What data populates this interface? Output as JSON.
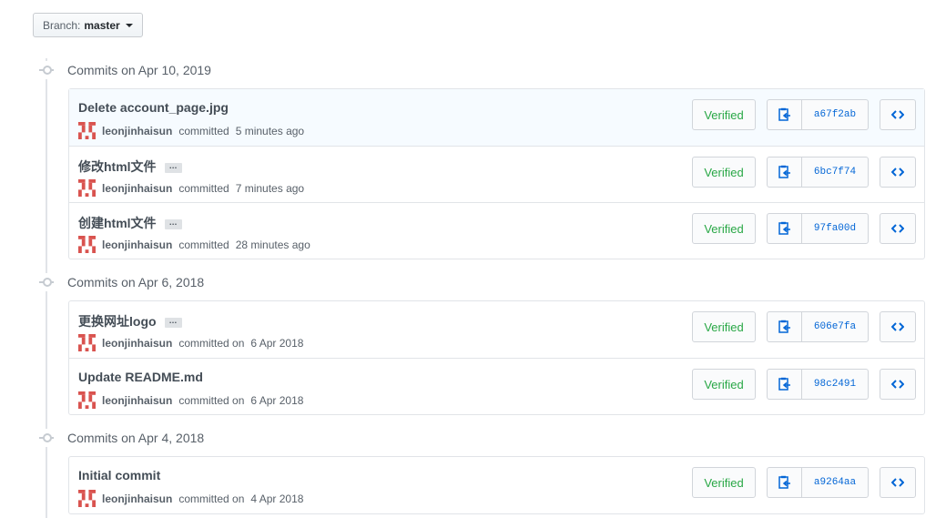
{
  "branch": {
    "label": "Branch:",
    "name": "master"
  },
  "groups": [
    {
      "title": "Commits on Apr 10, 2019",
      "commits": [
        {
          "message": "Delete account_page.jpg",
          "has_ellipsis": false,
          "author": "leonjinhaisun",
          "action": "committed",
          "time": "5 minutes ago",
          "verified": "Verified",
          "sha": "a67f2ab",
          "highlight": true
        },
        {
          "message": "修改html文件",
          "has_ellipsis": true,
          "author": "leonjinhaisun",
          "action": "committed",
          "time": "7 minutes ago",
          "verified": "Verified",
          "sha": "6bc7f74"
        },
        {
          "message": "创建html文件",
          "has_ellipsis": true,
          "author": "leonjinhaisun",
          "action": "committed",
          "time": "28 minutes ago",
          "verified": "Verified",
          "sha": "97fa00d"
        }
      ]
    },
    {
      "title": "Commits on Apr 6, 2018",
      "commits": [
        {
          "message": "更换网址logo",
          "has_ellipsis": true,
          "author": "leonjinhaisun",
          "action": "committed on",
          "time": "6 Apr 2018",
          "verified": "Verified",
          "sha": "606e7fa"
        },
        {
          "message": "Update README.md",
          "has_ellipsis": false,
          "author": "leonjinhaisun",
          "action": "committed on",
          "time": "6 Apr 2018",
          "verified": "Verified",
          "sha": "98c2491"
        }
      ]
    },
    {
      "title": "Commits on Apr 4, 2018",
      "commits": [
        {
          "message": "Initial commit",
          "has_ellipsis": false,
          "author": "leonjinhaisun",
          "action": "committed on",
          "time": "4 Apr 2018",
          "verified": "Verified",
          "sha": "a9264aa"
        }
      ]
    }
  ],
  "icons": {
    "copy": "clippy-icon",
    "browse": "code-icon",
    "commit": "git-commit-icon",
    "caret": "triangle-down-icon",
    "avatar": "identicon-avatar"
  },
  "colors": {
    "verified": "#28a745",
    "sha": "#0366d6",
    "highlight_row": "#f6fbff",
    "avatar": "#d9534f"
  }
}
